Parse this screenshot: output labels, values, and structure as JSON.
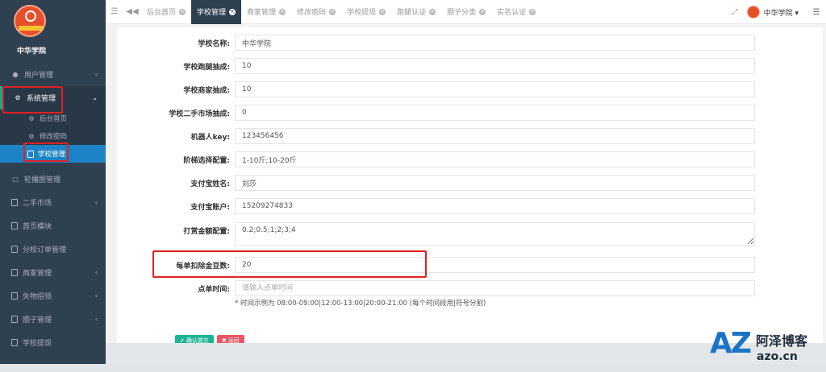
{
  "sidebar": {
    "school_name": "中华学院",
    "items": [
      {
        "label": "用户管理"
      },
      {
        "label": "系统管理"
      },
      {
        "label": "轮播图管理"
      },
      {
        "label": "二手市场"
      },
      {
        "label": "首页模块"
      },
      {
        "label": "分校订单管理"
      },
      {
        "label": "商家管理"
      },
      {
        "label": "失物招领"
      },
      {
        "label": "圈子管理"
      },
      {
        "label": "学校提现"
      }
    ],
    "sub_items": [
      {
        "label": "后台首页"
      },
      {
        "label": "修改密码"
      },
      {
        "label": "学校管理"
      }
    ]
  },
  "topbar": {
    "tabs": [
      {
        "label": "后台首页"
      },
      {
        "label": "学校管理"
      },
      {
        "label": "商家管理"
      },
      {
        "label": "修改密码"
      },
      {
        "label": "学校提现"
      },
      {
        "label": "跑腿认证"
      },
      {
        "label": "圈子分类"
      },
      {
        "label": "实名认证"
      }
    ],
    "user_name": "中华学院"
  },
  "form": {
    "school_name": {
      "label": "学校名称:",
      "value": "中华学院"
    },
    "errand_cut": {
      "label": "学校跑腿抽成:",
      "value": "10"
    },
    "merchant_cut": {
      "label": "学校商家抽成:",
      "value": "10"
    },
    "secondhand_cut": {
      "label": "学校二手市场抽成:",
      "value": "0"
    },
    "robot_key": {
      "label": "机器人key:",
      "value": "123456456"
    },
    "tier_config": {
      "label": "阶梯选择配置:",
      "value": "1-10斤;10-20斤"
    },
    "alipay_name": {
      "label": "支付宝姓名:",
      "value": "刘莎"
    },
    "alipay_account": {
      "label": "支付宝账户:",
      "value": "15209274833"
    },
    "tip_config": {
      "label": "打赏金额配置:",
      "value": "0.2;0.5;1;2;3;4"
    },
    "beans_per_order": {
      "label": "每单扣除金豆数:",
      "value": "20"
    },
    "order_time": {
      "label": "点单时间:",
      "placeholder": "请输入点单时间"
    },
    "help_text": "* 时间示例为 08:00-09:00|12:00-13:00|20:00-21:00 (每个时间段用|符号分割)"
  },
  "actions": {
    "save_label": "确认提交",
    "back_label": "返回"
  },
  "watermark": {
    "mark": "AZ",
    "name": "阿泽博客",
    "url": "azo.cn"
  },
  "colors": {
    "sidebar_bg": "#2f4050",
    "active_blue": "#1c84c6",
    "save_green": "#1ab394",
    "back_red": "#ed5565",
    "highlight_red": "#e02020"
  }
}
